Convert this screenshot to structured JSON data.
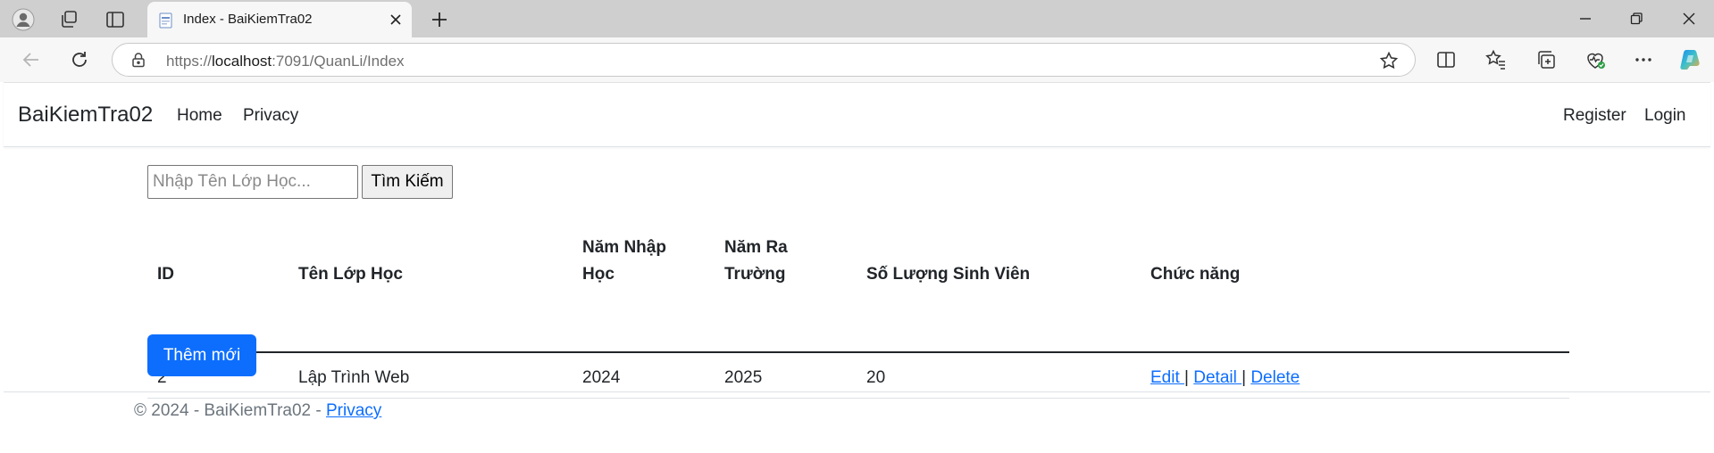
{
  "browser": {
    "tab": {
      "title": "Index - BaiKiemTra02"
    },
    "address": {
      "prefix": "https://",
      "host": "localhost",
      "rest": ":7091/QuanLi/Index"
    },
    "icons": [
      "profile-icon",
      "workspaces-icon",
      "tab-actions-icon",
      "favicon-icon",
      "close-tab-icon",
      "new-tab-icon",
      "minimize-icon",
      "restore-icon",
      "close-window-icon",
      "back-icon",
      "refresh-icon",
      "lock-icon",
      "favorite-star-icon",
      "split-screen-icon",
      "favorites-icon",
      "collections-icon",
      "browser-essentials-icon",
      "more-icon",
      "copilot-icon"
    ]
  },
  "navbar": {
    "brand": "BaiKiemTra02",
    "links": [
      "Home",
      "Privacy"
    ],
    "right_links": [
      "Register",
      "Login"
    ]
  },
  "search": {
    "placeholder": "Nhập Tên Lớp Học...",
    "button": "Tìm Kiếm"
  },
  "table": {
    "headers": {
      "id": "ID",
      "name": "Tên Lớp Học",
      "start_1": "Năm Nhập",
      "start_2": "Học",
      "end_1": "Năm Ra",
      "end_2": "Trường",
      "count": "Số Lượng Sinh Viên",
      "actions": "Chức năng"
    },
    "rows": [
      {
        "id": "2",
        "name": "Lập Trình Web",
        "start": "2024",
        "end": "2025",
        "count": "20",
        "edit": "Edit ",
        "detail": "Detail ",
        "delete": "Delete"
      }
    ],
    "separator": "|"
  },
  "add_button": "Thêm mới",
  "footer": {
    "text": "© 2024 - BaiKiemTra02 - ",
    "link": "Privacy"
  },
  "colors": {
    "primary": "#0d6efd",
    "tabbar": "#cfcfcf",
    "toolbar": "#f7f7f7"
  }
}
